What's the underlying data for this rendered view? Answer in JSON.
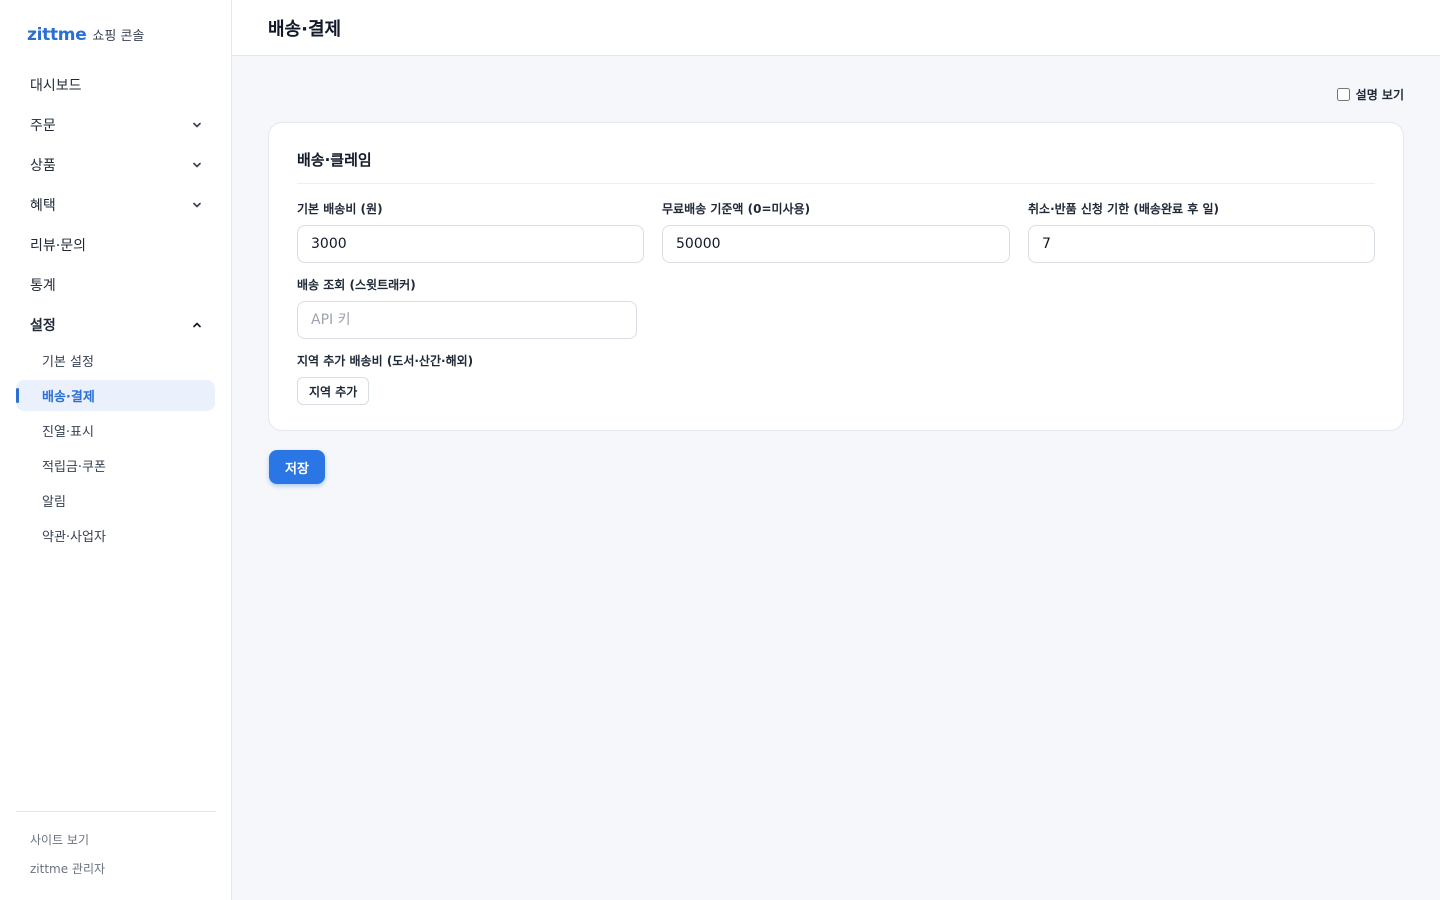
{
  "brand": {
    "logo": "zittme",
    "subtitle": "쇼핑 콘솔"
  },
  "nav": {
    "items": [
      {
        "label": "대시보드"
      },
      {
        "label": "주문"
      },
      {
        "label": "상품"
      },
      {
        "label": "혜택"
      },
      {
        "label": "리뷰·문의"
      },
      {
        "label": "통계"
      },
      {
        "label": "설정"
      }
    ],
    "settings_sub": [
      {
        "label": "기본 설정"
      },
      {
        "label": "배송·결제"
      },
      {
        "label": "진열·표시"
      },
      {
        "label": "적립금·쿠폰"
      },
      {
        "label": "알림"
      },
      {
        "label": "약관·사업자"
      }
    ]
  },
  "footer": {
    "view_site": "사이트 보기",
    "admin": "zittme 관리자"
  },
  "header": {
    "title": "배송·결제"
  },
  "help_toggle": {
    "label": "설명 보기",
    "checked": false
  },
  "card": {
    "title": "배송·클레임",
    "base_fee": {
      "label": "기본 배송비 (원)",
      "value": "3000"
    },
    "free_threshold": {
      "label": "무료배송 기준액 (0=미사용)",
      "value": "50000"
    },
    "return_deadline": {
      "label": "취소·반품 신청 기한 (배송완료 후 일)",
      "value": "7"
    },
    "tracking": {
      "label": "배송 조회 (스윗트래커)",
      "placeholder": "API 키"
    },
    "regional": {
      "label": "지역 추가 배송비 (도서·산간·해외)",
      "button": "지역 추가"
    }
  },
  "save_button": "저장",
  "colors": {
    "accent": "#2b76e5",
    "active_bg": "#eaf1fd"
  }
}
